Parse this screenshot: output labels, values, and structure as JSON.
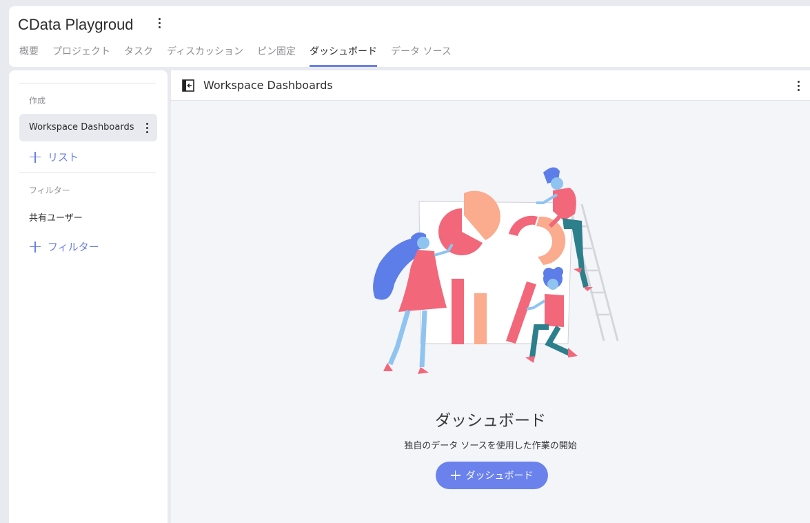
{
  "header": {
    "title": "CData Playgroud",
    "tabs": [
      {
        "label": "概要",
        "active": false
      },
      {
        "label": "プロジェクト",
        "active": false
      },
      {
        "label": "タスク",
        "active": false
      },
      {
        "label": "ディスカッション",
        "active": false
      },
      {
        "label": "ピン固定",
        "active": false
      },
      {
        "label": "ダッシュボード",
        "active": true
      },
      {
        "label": "データ ソース",
        "active": false
      }
    ]
  },
  "sidebar": {
    "create_section": "作成",
    "selected_item": "Workspace Dashboards",
    "add_list": "リスト",
    "filter_section": "フィルター",
    "shared_users": "共有ユーザー",
    "add_filter": "フィルター"
  },
  "main": {
    "title": "Workspace Dashboards",
    "empty_title": "ダッシュボード",
    "empty_subtitle": "独自のデータ ソースを使用した作業の開始",
    "cta_label": "ダッシュボード"
  },
  "colors": {
    "accent": "#6a7fe6",
    "cta": "#6b82ec",
    "illustration_red": "#f2677a",
    "illustration_peach": "#fbab8e",
    "illustration_blue": "#5d7ee8"
  },
  "icons": [
    "kebab-icon",
    "panel-collapse-icon",
    "plus-icon"
  ]
}
